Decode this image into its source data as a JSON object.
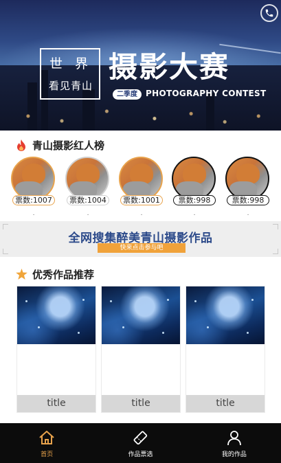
{
  "banner": {
    "logo_line1": "世 界",
    "logo_line2": "看见青山",
    "big_title": "摄影大赛",
    "season": "二季度",
    "contest": "PHOTOGRAPHY CONTEST"
  },
  "ranking": {
    "title": "青山摄影红人榜",
    "items": [
      {
        "votes": "票数:1007",
        "name": "."
      },
      {
        "votes": "票数:1004",
        "name": "."
      },
      {
        "votes": "票数:1001",
        "name": "."
      },
      {
        "votes": "票数:998",
        "name": "."
      },
      {
        "votes": "票数:998",
        "name": "."
      }
    ]
  },
  "promo": {
    "title": "全网搜集醉美青山摄影作品",
    "button": "快来点击参与吧"
  },
  "works": {
    "title": "优秀作品推荐",
    "items": [
      {
        "title": "title"
      },
      {
        "title": "title"
      },
      {
        "title": "title"
      }
    ]
  },
  "nav": {
    "items": [
      {
        "label": "首页",
        "icon": "home-icon"
      },
      {
        "label": "作品票选",
        "icon": "ticket-icon"
      },
      {
        "label": "我的作品",
        "icon": "user-icon"
      }
    ]
  },
  "colors": {
    "accent": "#e8a34c",
    "nav_bg": "#0c0c0c",
    "promo_text": "#2c4a8a"
  }
}
